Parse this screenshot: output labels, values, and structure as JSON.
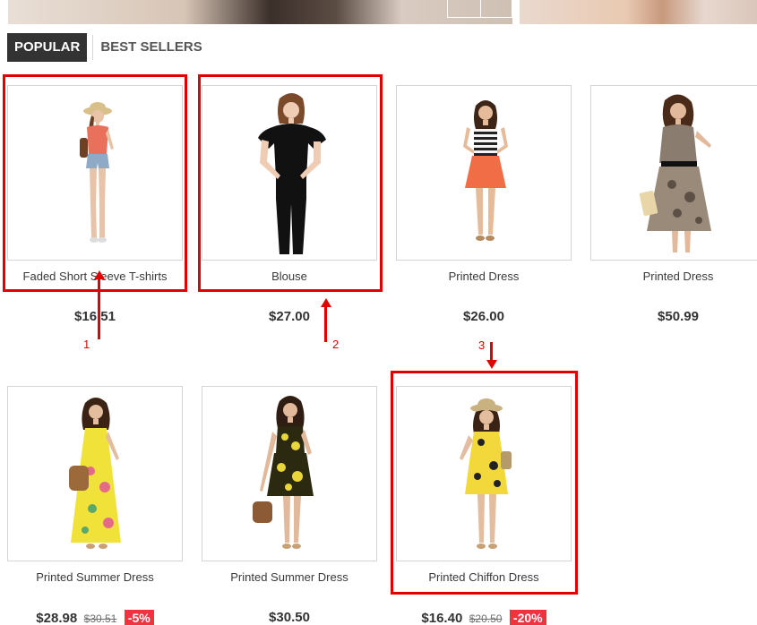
{
  "tabs": {
    "popular": "POPULAR",
    "best_sellers": "BEST SELLERS"
  },
  "products": [
    {
      "name": "Faded Short Sleeve T-shirts",
      "price": "$16.51",
      "old_price": "",
      "discount": "",
      "image": "woman-orange-top-denim-shorts"
    },
    {
      "name": "Blouse",
      "price": "$27.00",
      "old_price": "",
      "discount": "",
      "image": "woman-black-blouse"
    },
    {
      "name": "Printed Dress",
      "price": "$26.00",
      "old_price": "",
      "discount": "",
      "image": "woman-striped-top-orange-skirt"
    },
    {
      "name": "Printed Dress",
      "price": "$50.99",
      "old_price": "",
      "discount": "",
      "image": "woman-printed-dress"
    },
    {
      "name": "Printed Summer Dress",
      "price": "$28.98",
      "old_price": "$30.51",
      "discount": "-5%",
      "image": "woman-yellow-maxi-dress"
    },
    {
      "name": "Printed Summer Dress",
      "price": "$30.50",
      "old_price": "",
      "discount": "",
      "image": "woman-yellow-black-dress"
    },
    {
      "name": "Printed Chiffon Dress",
      "price": "$16.40",
      "old_price": "$20.50",
      "discount": "-20%",
      "image": "woman-yellow-chiffon-dress"
    }
  ],
  "annotations": [
    {
      "label": "1",
      "direction": "up"
    },
    {
      "label": "2",
      "direction": "up"
    },
    {
      "label": "3",
      "direction": "down"
    }
  ],
  "colors": {
    "highlight": "#e00000",
    "tab_active_bg": "#333333",
    "discount_bg": "#f13340"
  }
}
